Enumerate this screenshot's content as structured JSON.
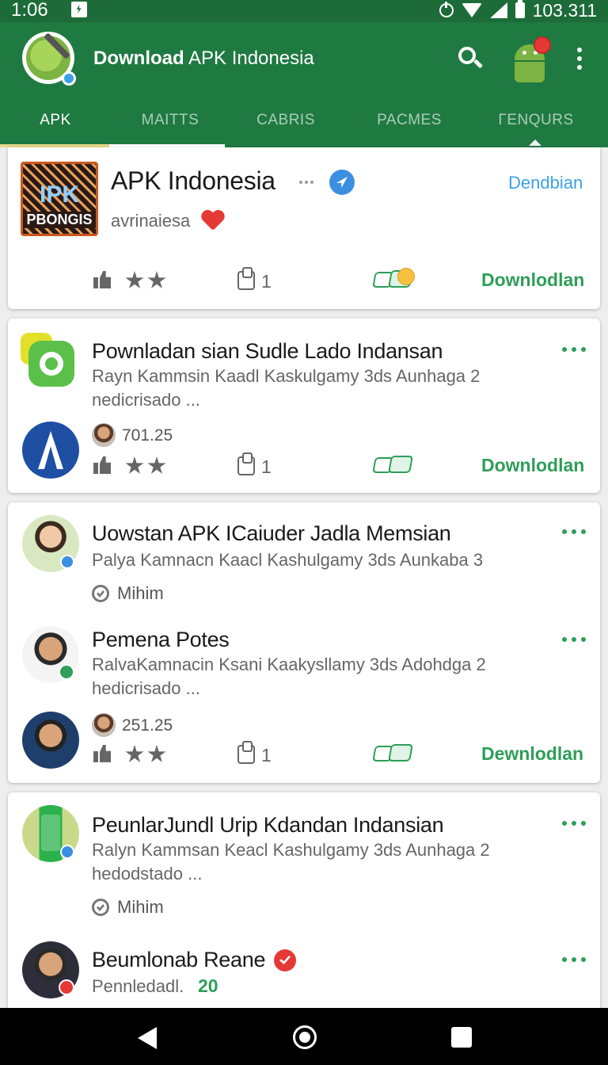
{
  "status_bar": {
    "time": "1:06",
    "level": "103.311"
  },
  "app_bar": {
    "title_bold": "Download",
    "title_rest": " APK Indonesia"
  },
  "tabs": [
    {
      "label": "APK",
      "active": true
    },
    {
      "label": "MAITTS"
    },
    {
      "label": "CABRIS"
    },
    {
      "label": "PACMES"
    },
    {
      "label": "ΓENQURS"
    }
  ],
  "card1": {
    "logo_top": "IPK",
    "logo_bottom": "PBONGIS",
    "title": "APK Indonesia",
    "follow_label": "Dendbian",
    "subtitle": "avrinaiesa",
    "count": "1",
    "download_label": "Downlodlan"
  },
  "card2": {
    "title": "Pownladan sian Sudle Lado Indansan",
    "desc": "Rayn Kammsin Kaadl Kaskulgamy 3ds Aunhaga 2 nedicrisado ...",
    "stat": "701.25",
    "count": "1",
    "download_label": "Downlodlan"
  },
  "card3": {
    "item1": {
      "title": "Uowstan APK ICaiuder Jadla Memsian",
      "desc": "Palya Kamnacn Kaacl Kashulgamy 3ds Aunkaba 3",
      "minim_label": "Mihim"
    },
    "item2": {
      "title": "Pemena Potes",
      "desc": "RalvaKamnacin Ksani Kaakysllamy 3ds Adohdga 2 hedicrisado ...",
      "stat": "251.25",
      "count": "1",
      "download_label": "Dewnlodlan"
    }
  },
  "card4": {
    "item1": {
      "title": "PeunlarJundl Urip Kdandan Indansian",
      "desc": "Ralyn Kammsan Keacl Kashulgamy 3ds Aunhaga 2 hedodstado ...",
      "minim_label": "Mihim"
    },
    "item2": {
      "title": "Beumlonab Reane",
      "meta_label": "Pennledadl.",
      "meta_value": "20"
    }
  },
  "colors": {
    "primary": "#1f7a42",
    "accent": "#2e9e58",
    "link": "#3ba0e8"
  }
}
